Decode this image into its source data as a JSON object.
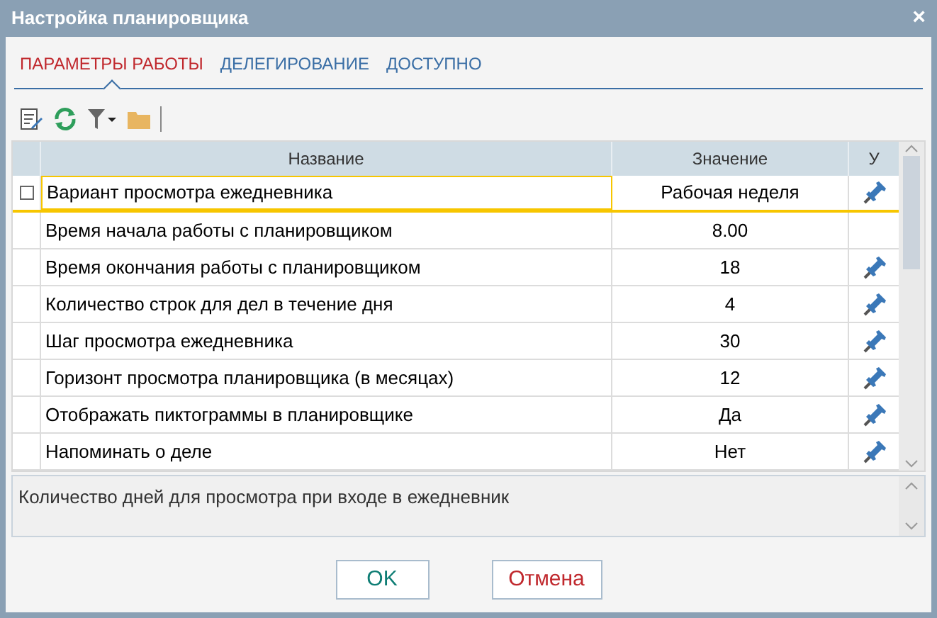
{
  "window": {
    "title": "Настройка планировщика",
    "close": "×"
  },
  "tabs": [
    {
      "label": "ПАРАМЕТРЫ РАБОТЫ",
      "selected": true
    },
    {
      "label": "ДЕЛЕГИРОВАНИЕ",
      "selected": false
    },
    {
      "label": "ДОСТУПНО",
      "selected": false
    }
  ],
  "table": {
    "columns": [
      "Название",
      "Значение",
      "У"
    ],
    "rows": [
      {
        "name": "Вариант просмотра ежедневника",
        "value": "Рабочая неделя",
        "pinned": true,
        "selected": true
      },
      {
        "name": "Время начала работы с планировщиком",
        "value": "8.00",
        "pinned": false,
        "selected": false
      },
      {
        "name": "Время окончания работы с планировщиком",
        "value": "18",
        "pinned": true,
        "selected": false
      },
      {
        "name": "Количество строк для дел в течение дня",
        "value": "4",
        "pinned": true,
        "selected": false
      },
      {
        "name": "Шаг просмотра ежедневника",
        "value": "30",
        "pinned": true,
        "selected": false
      },
      {
        "name": "Горизонт просмотра планировщика (в месяцах)",
        "value": "12",
        "pinned": true,
        "selected": false
      },
      {
        "name": "Отображать пиктограммы в планировщике",
        "value": "Да",
        "pinned": true,
        "selected": false
      },
      {
        "name": "Напоминать о деле",
        "value": "Нет",
        "pinned": true,
        "selected": false
      }
    ]
  },
  "description": "Количество дней для просмотра при входе в ежедневник",
  "buttons": [
    {
      "label": "OK",
      "kind": "ok"
    },
    {
      "label": "Отмена",
      "kind": "cancel"
    }
  ]
}
